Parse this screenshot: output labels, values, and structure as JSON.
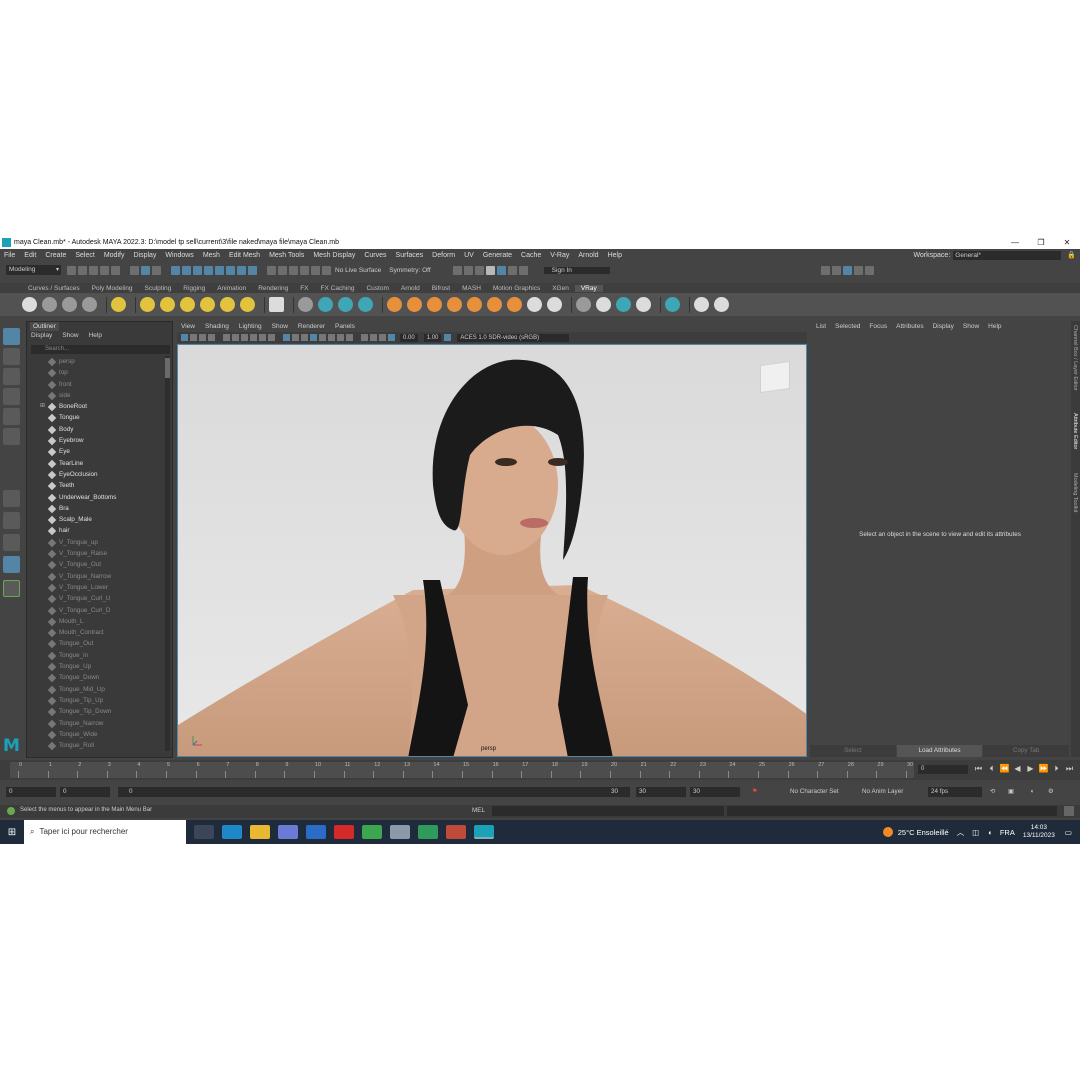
{
  "window": {
    "title": "maya Clean.mb* - Autodesk MAYA 2022.3: D:\\model tp sell\\current\\3\\file naked\\maya file\\maya Clean.mb",
    "minimize": "—",
    "restore": "❐",
    "close": "✕"
  },
  "menubar": {
    "items": [
      "File",
      "Edit",
      "Create",
      "Select",
      "Modify",
      "Display",
      "Windows",
      "Mesh",
      "Edit Mesh",
      "Mesh Tools",
      "Mesh Display",
      "Curves",
      "Surfaces",
      "Deform",
      "UV",
      "Generate",
      "Cache",
      "V-Ray",
      "Arnold",
      "Help"
    ],
    "workspace_label": "Workspace:",
    "workspace_value": "General*"
  },
  "statusline": {
    "mode": "Modeling",
    "live_surface": "No Live Surface",
    "symmetry": "Symmetry: Off",
    "sign_in": "Sign In"
  },
  "shelf": {
    "tabs": [
      "Curves / Surfaces",
      "Poly Modeling",
      "Sculpting",
      "Rigging",
      "Animation",
      "Rendering",
      "FX",
      "FX Caching",
      "Custom",
      "Arnold",
      "Bifrost",
      "MASH",
      "Motion Graphics",
      "XGen",
      "VRay"
    ],
    "active_tab": "VRay"
  },
  "outliner": {
    "tab": "Outliner",
    "menu": [
      "Display",
      "Show",
      "Help"
    ],
    "search_placeholder": "Search...",
    "items": [
      {
        "label": "persp",
        "dim": true
      },
      {
        "label": "top",
        "dim": true
      },
      {
        "label": "front",
        "dim": true
      },
      {
        "label": "side",
        "dim": true
      },
      {
        "label": "BoneRoot",
        "dim": false,
        "expand": true
      },
      {
        "label": "Tongue",
        "dim": false
      },
      {
        "label": "Body",
        "dim": false
      },
      {
        "label": "Eyebrow",
        "dim": false
      },
      {
        "label": "Eye",
        "dim": false
      },
      {
        "label": "TearLine",
        "dim": false
      },
      {
        "label": "EyeOcclusion",
        "dim": false
      },
      {
        "label": "Teeth",
        "dim": false
      },
      {
        "label": "Underwear_Bottoms",
        "dim": false
      },
      {
        "label": "Bra",
        "dim": false
      },
      {
        "label": "Scalp_Male",
        "dim": false
      },
      {
        "label": "hair",
        "dim": false
      },
      {
        "label": "V_Tongue_up",
        "dim": true
      },
      {
        "label": "V_Tongue_Raise",
        "dim": true
      },
      {
        "label": "V_Tongue_Out",
        "dim": true
      },
      {
        "label": "V_Tongue_Narrow",
        "dim": true
      },
      {
        "label": "V_Tongue_Lower",
        "dim": true
      },
      {
        "label": "V_Tongue_Curl_U",
        "dim": true
      },
      {
        "label": "V_Tongue_Curl_D",
        "dim": true
      },
      {
        "label": "Mouth_L",
        "dim": true
      },
      {
        "label": "Mouth_Contract",
        "dim": true
      },
      {
        "label": "Tongue_Out",
        "dim": true
      },
      {
        "label": "Tongue_in",
        "dim": true
      },
      {
        "label": "Tongue_Up",
        "dim": true
      },
      {
        "label": "Tongue_Down",
        "dim": true
      },
      {
        "label": "Tongue_Mid_Up",
        "dim": true
      },
      {
        "label": "Tongue_Tip_Up",
        "dim": true
      },
      {
        "label": "Tongue_Tip_Down",
        "dim": true
      },
      {
        "label": "Tongue_Narrow",
        "dim": true
      },
      {
        "label": "Tongue_Wide",
        "dim": true
      },
      {
        "label": "Tongue_Roll",
        "dim": true
      }
    ]
  },
  "viewport": {
    "menu": [
      "View",
      "Shading",
      "Lighting",
      "Show",
      "Renderer",
      "Panels"
    ],
    "exposure": "0.00",
    "gamma": "1.00",
    "colorspace": "ACES 1.0 SDR-video (sRGB)",
    "camera_label": "persp"
  },
  "attribute_editor": {
    "menu": [
      "List",
      "Selected",
      "Focus",
      "Attributes",
      "Display",
      "Show",
      "Help"
    ],
    "message": "Select an object in the scene to view and edit its attributes",
    "buttons": [
      "Select",
      "Load Attributes",
      "Copy Tab"
    ],
    "side_tabs": [
      "Channel Box / Layer Editor",
      "Attribute Editor",
      "Modeling Toolkit"
    ]
  },
  "timeline": {
    "ticks": [
      "0",
      "1",
      "2",
      "3",
      "4",
      "5",
      "6",
      "7",
      "8",
      "9",
      "10",
      "11",
      "12",
      "13",
      "14",
      "15",
      "16",
      "17",
      "18",
      "19",
      "20",
      "21",
      "22",
      "23",
      "24",
      "25",
      "26",
      "27",
      "28",
      "29",
      "30"
    ],
    "current_frame": "0"
  },
  "range": {
    "start": "0",
    "playback_start": "0",
    "slider_left": "0",
    "slider_right": "30",
    "playback_end": "30",
    "end": "30",
    "character_set": "No Character Set",
    "anim_layer": "No Anim Layer",
    "fps": "24 fps"
  },
  "helpline": {
    "message": "Select the menus to appear in the Main Menu Bar",
    "mel_label": "MEL"
  },
  "taskbar": {
    "search_placeholder": "Taper ici pour rechercher",
    "weather": "25°C  Ensoleillé",
    "language": "FRA",
    "time": "14:03",
    "date": "13/11/2023"
  },
  "colors": {
    "accent": "#5285a6",
    "maya_teal": "#1aa3b8",
    "panel": "#444444",
    "field": "#2b2b2b"
  }
}
